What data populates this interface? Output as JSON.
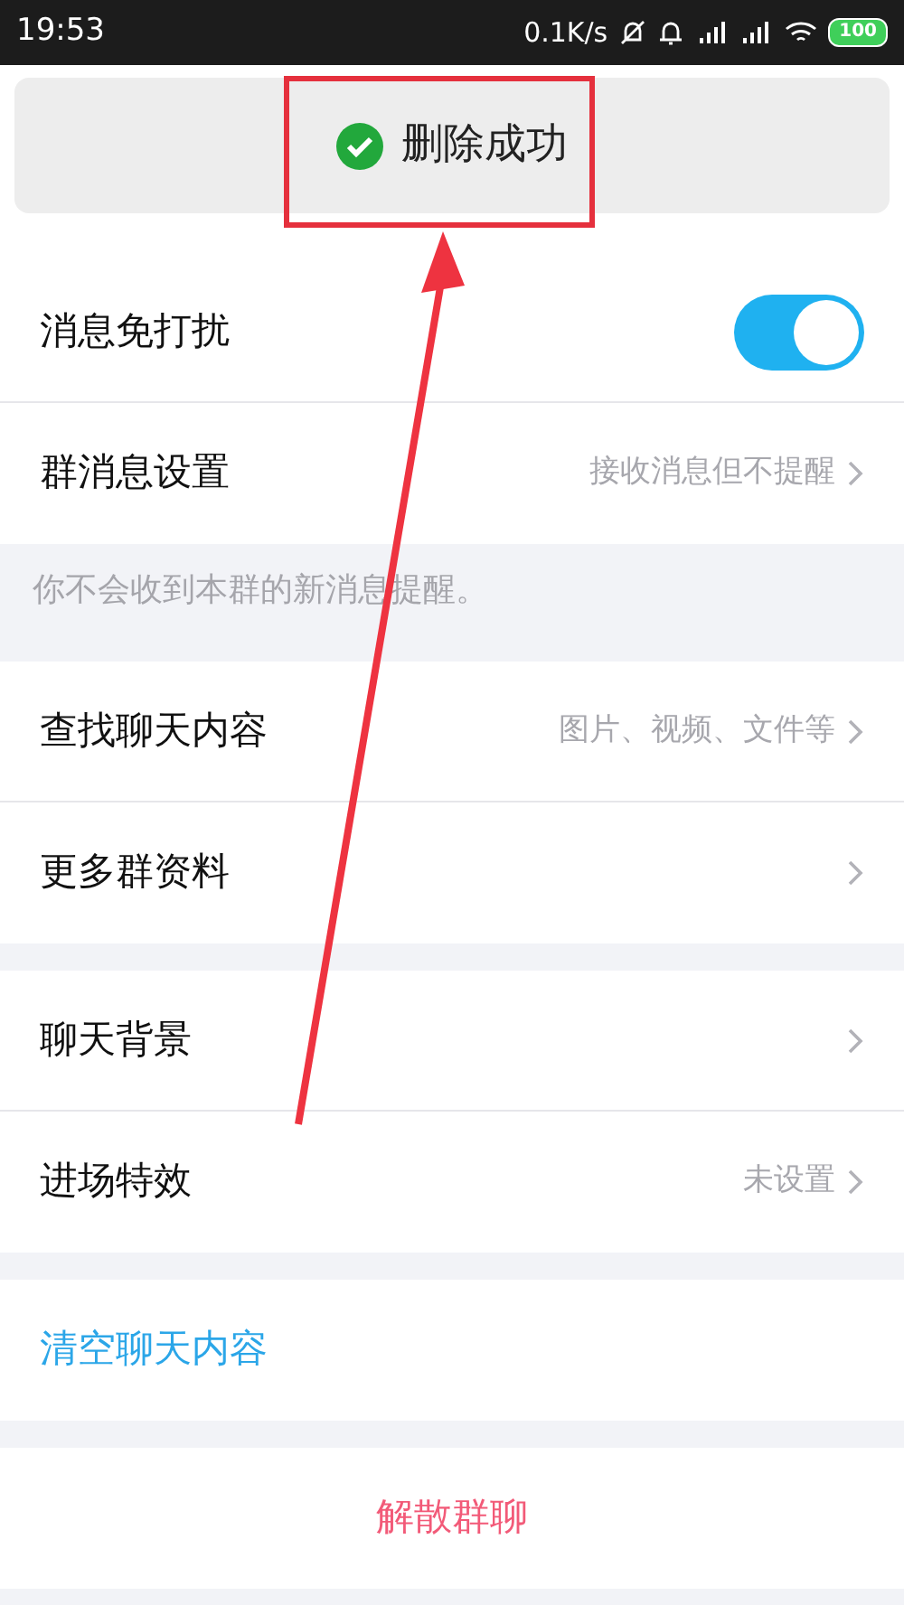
{
  "status_bar": {
    "time": "19:53",
    "network_speed": "0.1K/s",
    "battery": "100"
  },
  "toast": {
    "text": "删除成功"
  },
  "sections": [
    {
      "rows": [
        {
          "kind": "toggle",
          "label": "消息免打扰",
          "on": true
        },
        {
          "kind": "link",
          "label": "群消息设置",
          "value": "接收消息但不提醒"
        }
      ],
      "note": "你不会收到本群的新消息提醒。"
    },
    {
      "rows": [
        {
          "kind": "link",
          "label": "查找聊天内容",
          "value": "图片、视频、文件等"
        },
        {
          "kind": "link",
          "label": "更多群资料"
        }
      ]
    },
    {
      "rows": [
        {
          "kind": "link",
          "label": "聊天背景"
        },
        {
          "kind": "link",
          "label": "进场特效",
          "value": "未设置"
        }
      ]
    },
    {
      "rows": [
        {
          "kind": "action",
          "label": "清空聊天内容"
        }
      ]
    },
    {
      "rows": [
        {
          "kind": "danger",
          "label": "解散群聊"
        }
      ]
    }
  ]
}
